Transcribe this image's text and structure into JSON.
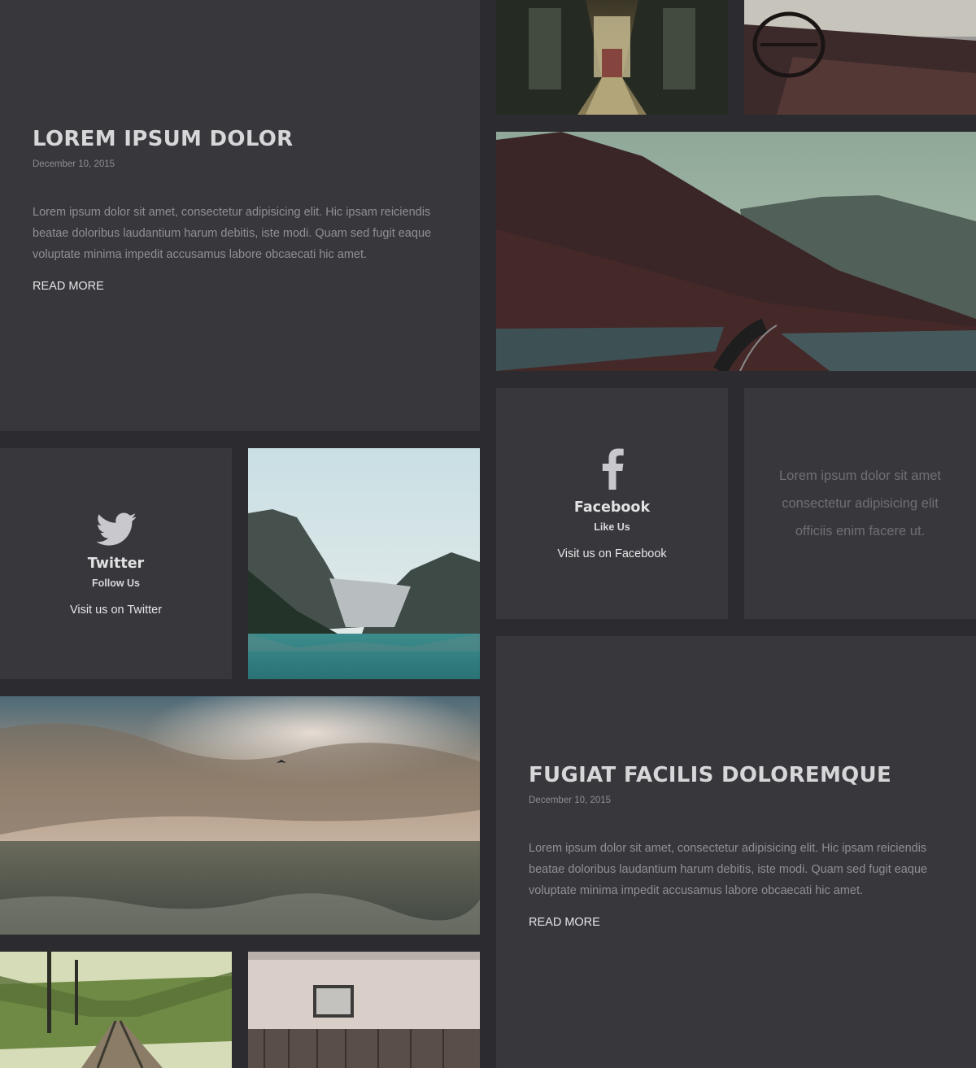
{
  "posts": [
    {
      "title": "LOREM IPSUM DOLOR",
      "date": "December 10, 2015",
      "excerpt": "Lorem ipsum dolor sit amet, consectetur adipisicing elit. Hic ipsam reiciendis beatae doloribus laudantium harum debitis, iste modi. Quam sed fugit eaque voluptate minima impedit accusamus labore obcaecati hic amet.",
      "read_more": "READ MORE"
    },
    {
      "title": "FUGIAT FACILIS DOLOREMQUE",
      "date": "December 10, 2015",
      "excerpt": "Lorem ipsum dolor sit amet, consectetur adipisicing elit. Hic ipsam reiciendis beatae doloribus laudantium harum debitis, iste modi. Quam sed fugit eaque voluptate minima impedit accusamus labore obcaecati hic amet.",
      "read_more": "READ MORE"
    }
  ],
  "social": {
    "twitter": {
      "icon": "twitter-bird-icon",
      "name": "Twitter",
      "subtitle": "Follow Us",
      "link": "Visit us on Twitter"
    },
    "facebook": {
      "icon": "facebook-f-icon",
      "name": "Facebook",
      "subtitle": "Like Us",
      "link": "Visit us on Facebook"
    }
  },
  "quote": {
    "text": "Lorem ipsum dolor sit amet consectetur adipisicing elit officiis enim facere ut."
  },
  "colors": {
    "background": "#2c2c30",
    "panel": "#37373c",
    "icon": "#c9c9cd"
  }
}
